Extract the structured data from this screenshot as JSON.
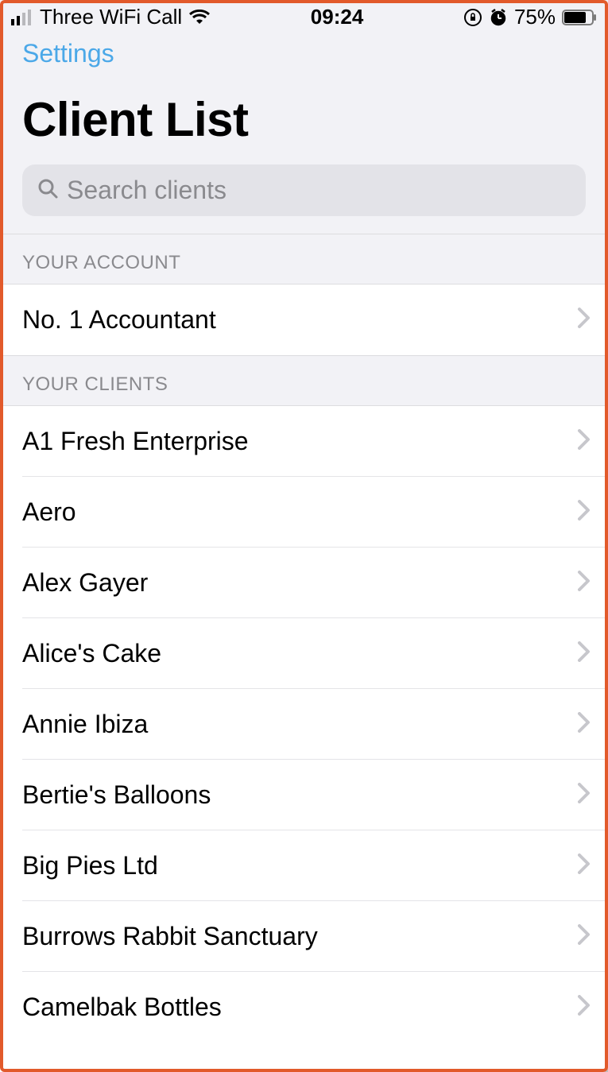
{
  "status": {
    "carrier": "Three WiFi Call",
    "time": "09:24",
    "battery_pct": "75%"
  },
  "nav": {
    "back_label": "Settings"
  },
  "title": "Client List",
  "search": {
    "placeholder": "Search clients"
  },
  "sections": {
    "account_header": "YOUR ACCOUNT",
    "clients_header": "YOUR CLIENTS"
  },
  "account": {
    "name": "No. 1 Accountant"
  },
  "clients": [
    {
      "name": "A1 Fresh Enterprise"
    },
    {
      "name": "Aero"
    },
    {
      "name": "Alex Gayer"
    },
    {
      "name": "Alice's Cake"
    },
    {
      "name": "Annie Ibiza"
    },
    {
      "name": "Bertie's Balloons"
    },
    {
      "name": "Big Pies Ltd"
    },
    {
      "name": "Burrows Rabbit Sanctuary"
    },
    {
      "name": "Camelbak Bottles"
    }
  ]
}
